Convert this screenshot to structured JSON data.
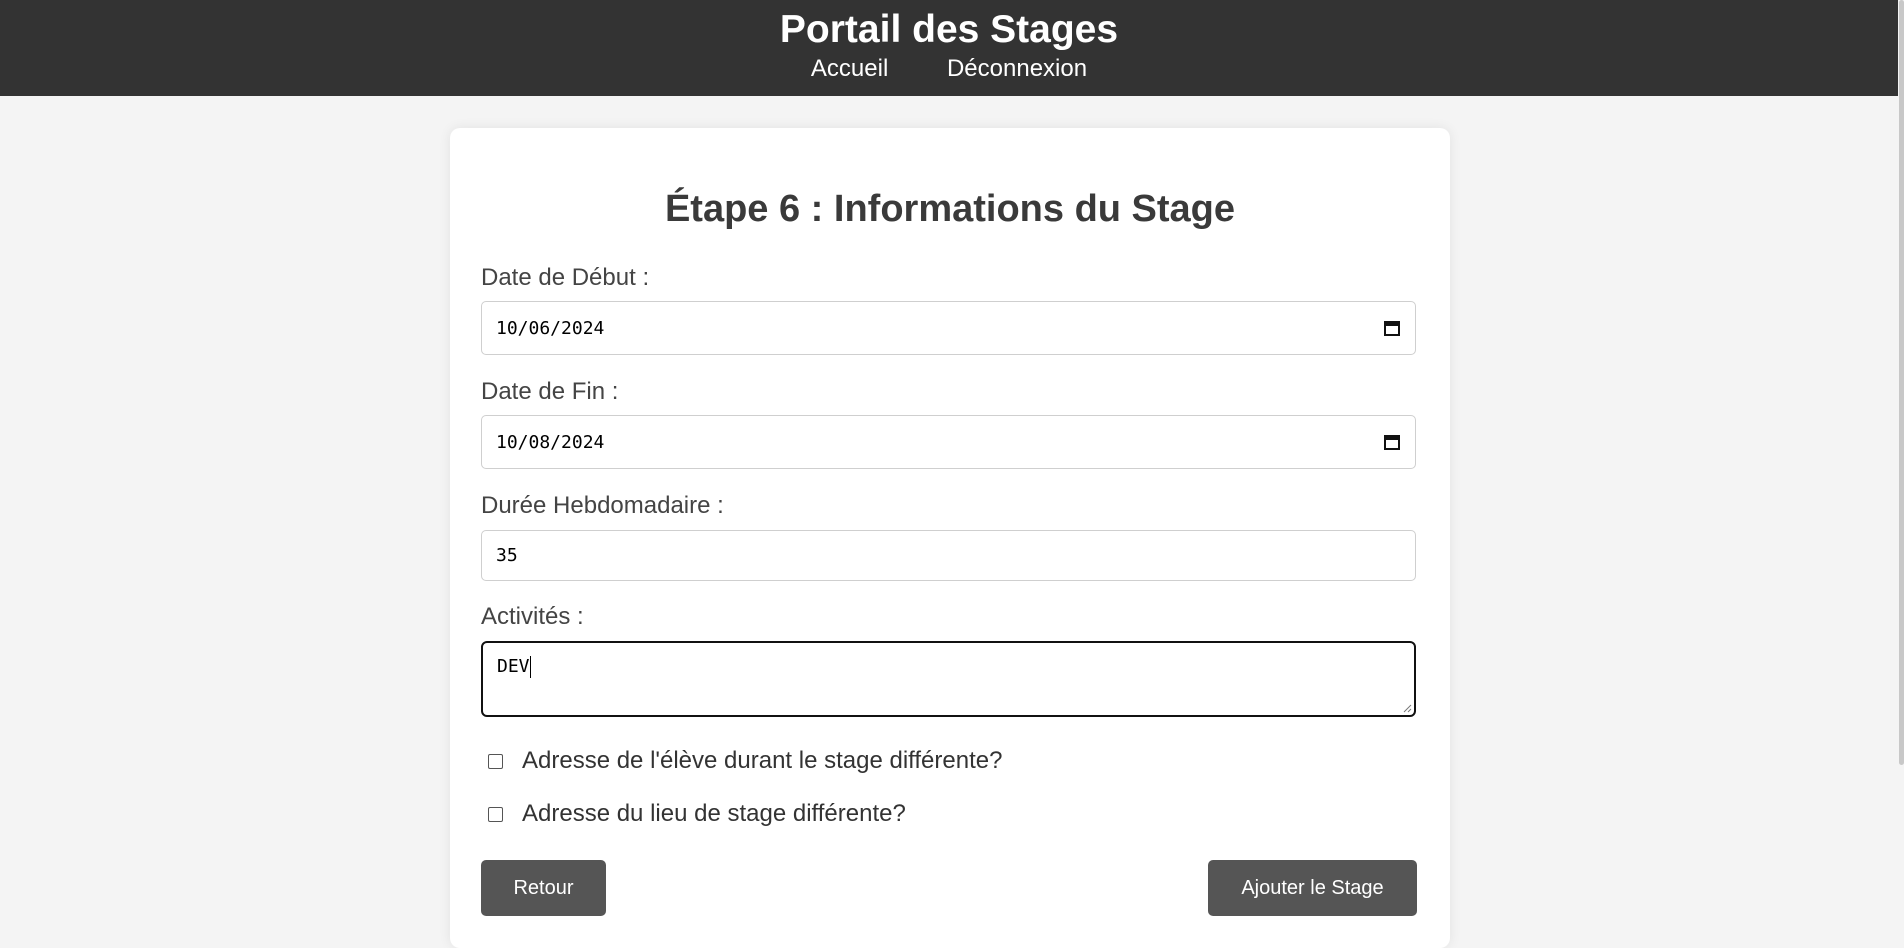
{
  "header": {
    "title": "Portail des Stages",
    "nav": [
      "Accueil",
      "Déconnexion"
    ]
  },
  "form": {
    "heading": "Étape 6 : Informations du Stage",
    "fields": {
      "start_date": {
        "label": "Date de Début :",
        "value": "10/06/2024"
      },
      "end_date": {
        "label": "Date de Fin :",
        "value": "10/08/2024"
      },
      "weekly_hours": {
        "label": "Durée Hebdomadaire :",
        "value": "35"
      },
      "activities": {
        "label": "Activités :",
        "value": "DEV"
      }
    },
    "checkboxes": [
      {
        "label": "Adresse de l'élève durant le stage différente?",
        "checked": false
      },
      {
        "label": "Adresse du lieu de stage différente?",
        "checked": false
      }
    ],
    "buttons": {
      "back": "Retour",
      "submit": "Ajouter le Stage"
    }
  },
  "colors": {
    "header_bg": "#333333",
    "page_bg": "#f4f4f4",
    "button_bg": "#555555"
  }
}
